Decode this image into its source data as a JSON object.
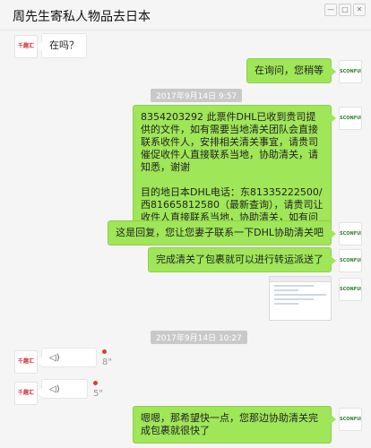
{
  "window": {
    "title": "周先生寄私人物品去日本",
    "controls": [
      "minimize-icon",
      "maximize-icon",
      "close-icon"
    ]
  },
  "avatars": {
    "left_brand": "千趣汇",
    "right_brand": "SCONFUN"
  },
  "messages": {
    "m1": "在吗？",
    "m2": "在询问，您稍等",
    "ts1": "2017年9月14日 9:57",
    "m3_p1": "8354203292  此票件DHL已收到贵司提供的文件，如有需要当地清关团队会直接联系收件人，安排相关清关事宜，请贵司催促收件人直接联系当地，协助清关，请知悉，谢谢",
    "m3_p2": "目的地日本DHL电话：东81335222500/西81665812580（最新查询），请贵司让收件人直接联系当地，协助清关，如有问题请及时反馈，谢谢",
    "m4": "这是回复，您让您妻子联系一下DHL协助清关吧",
    "m5": "完成清关了包裹就可以进行转运派送了",
    "ts2": "2017年9月14日 10:27",
    "voice1_duration": "8\"",
    "voice2_duration": "5\"",
    "m6": "嗯嗯，那希望快一点，您那边协助清关完成包裹就很快了"
  },
  "colors": {
    "outgoing_bubble": "#9fe658",
    "incoming_bubble": "#ffffff",
    "unread": "#e53935"
  }
}
